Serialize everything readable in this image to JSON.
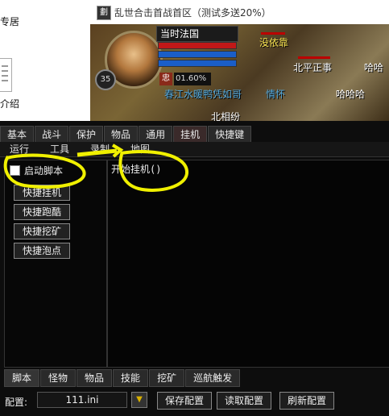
{
  "desktop": {
    "icon_label_1": "专居",
    "icon_label_2": "介绍"
  },
  "window": {
    "app_icon": "劃",
    "title": "乱世合击首战首区（测试多送20%）"
  },
  "game": {
    "level": "35",
    "player_name": "当时法国",
    "buff_label": "忠",
    "exp_percent": "01.60%",
    "names": [
      "没依靠",
      "北平正事",
      "哈哈",
      "春江水暖鸭凭如哥",
      "情怀",
      "哈哈哈",
      "北相纷"
    ]
  },
  "tabs": [
    "基本",
    "战斗",
    "保护",
    "物品",
    "通用",
    "挂机",
    "快捷键"
  ],
  "active_tab": "挂机",
  "subtabs": [
    "运行",
    "工具",
    "录制",
    "地图"
  ],
  "left": {
    "checkbox_label": "启动脚本",
    "buttons": [
      "快捷挂机",
      "快捷跑酷",
      "快捷挖矿",
      "快捷泡点"
    ]
  },
  "script_text": "开始挂机()",
  "bottom_tabs": [
    "脚本",
    "怪物",
    "物品",
    "技能",
    "挖矿",
    "巡航触发"
  ],
  "config": {
    "label": "配置:",
    "value": "111.ini",
    "save": "保存配置",
    "load": "读取配置",
    "refresh": "刷新配置"
  },
  "colors": {
    "annotation": "#f0f000",
    "panel_bg": "#0d0d0d"
  }
}
